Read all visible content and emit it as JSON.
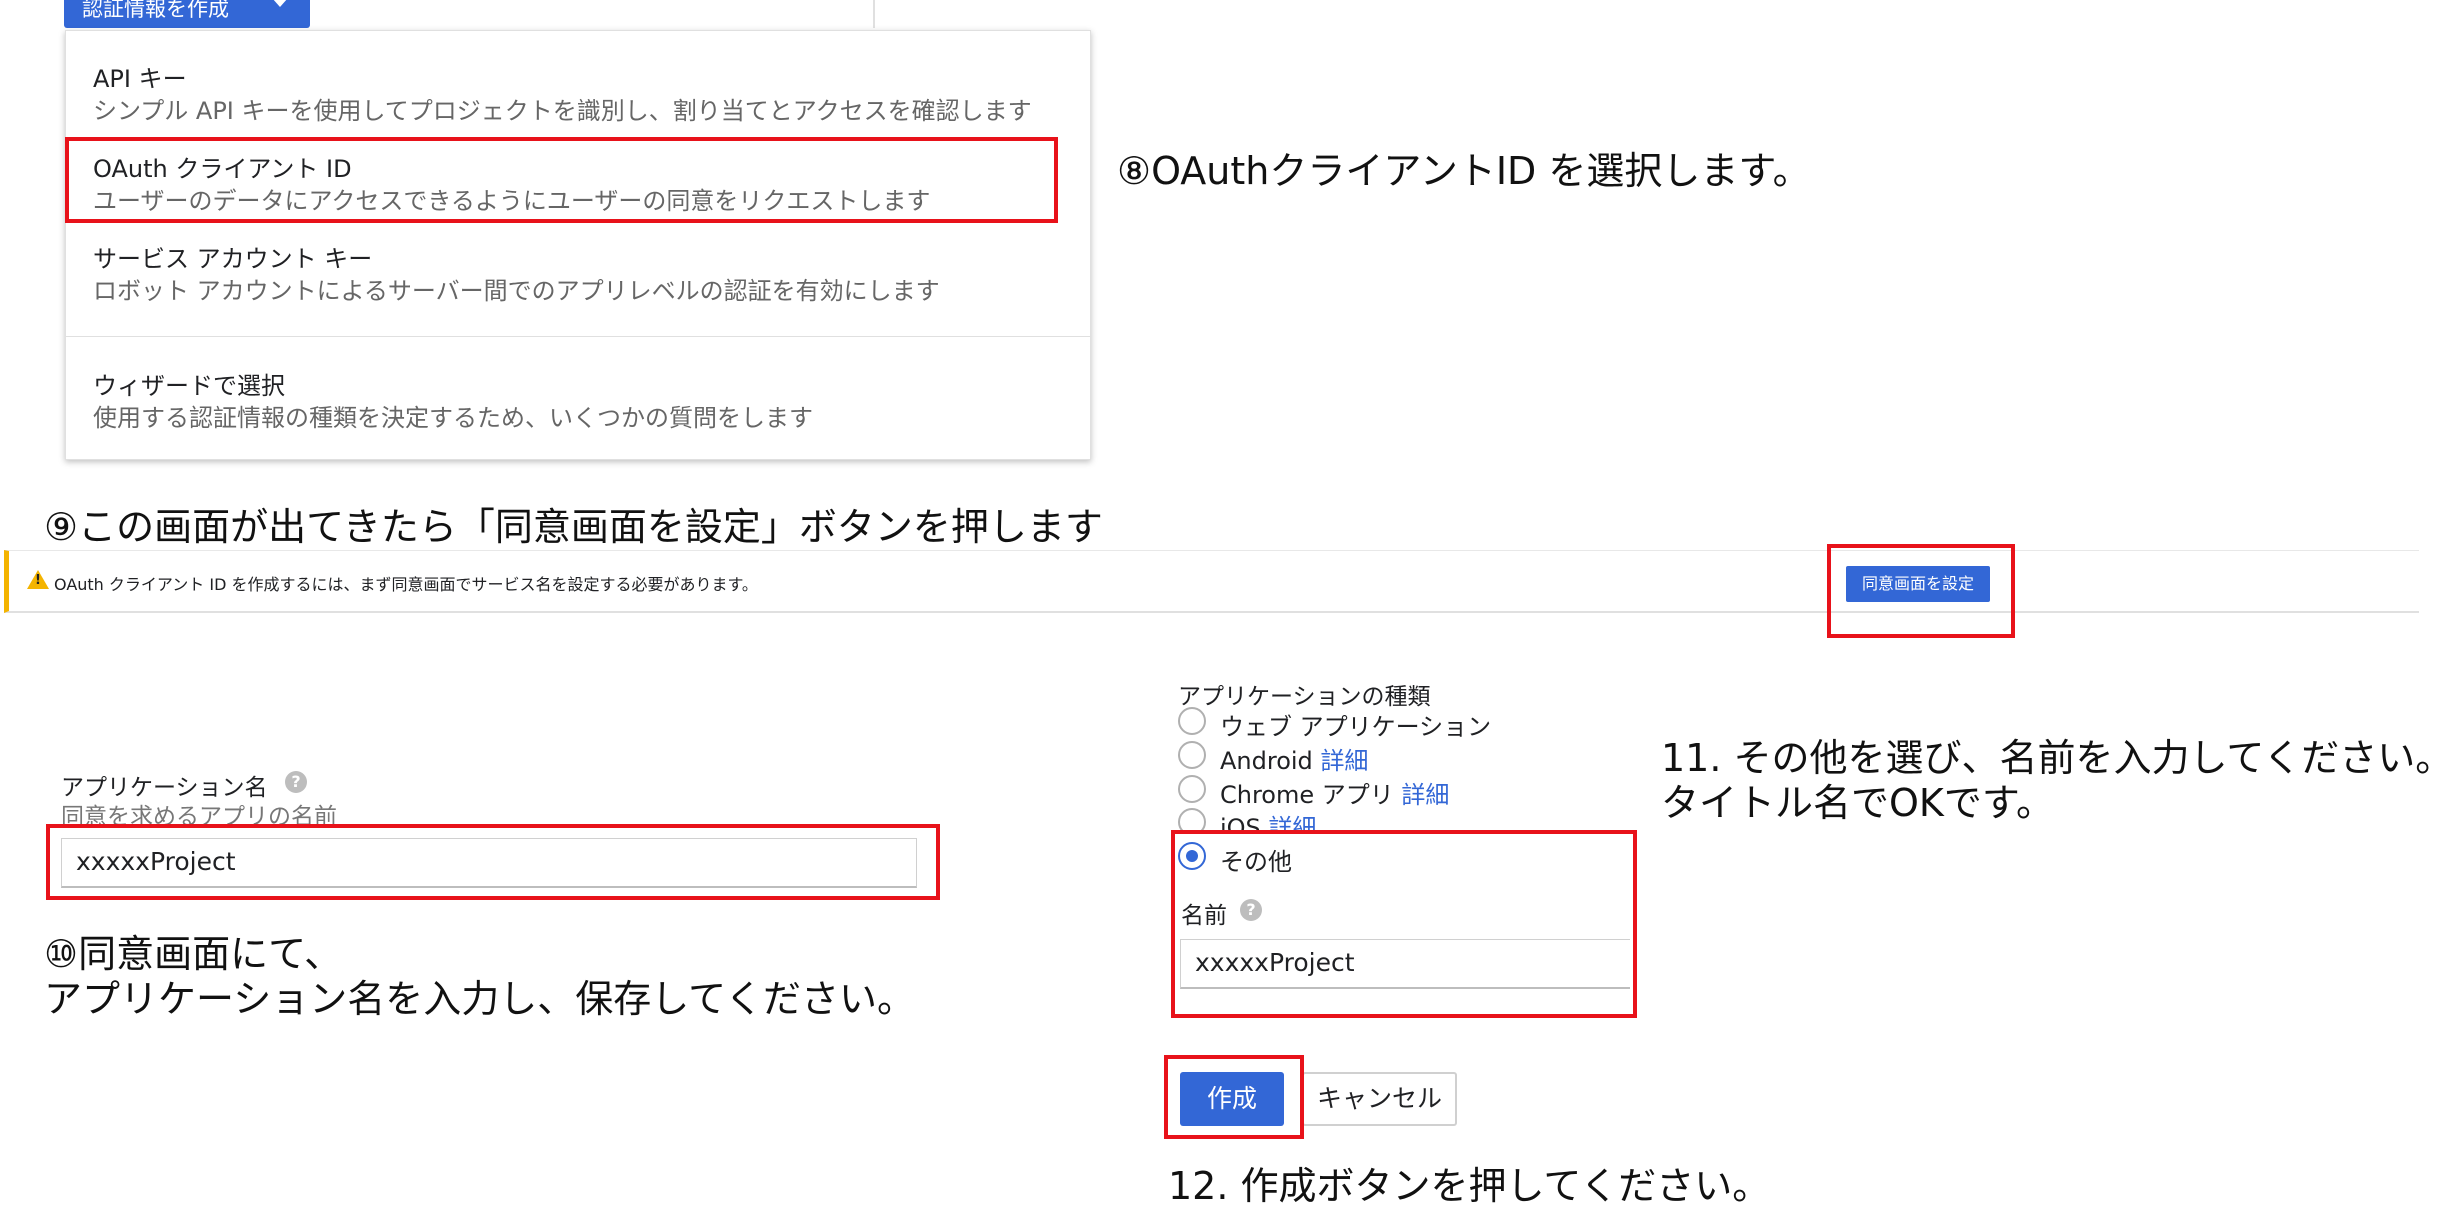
{
  "create_button": {
    "label": "認証情報を作成"
  },
  "menu": {
    "items": [
      {
        "title": "API キー",
        "desc": "シンプル API キーを使用してプロジェクトを識別し、割り当てとアクセスを確認します"
      },
      {
        "title": "OAuth クライアント ID",
        "desc": "ユーザーのデータにアクセスできるようにユーザーの同意をリクエストします"
      },
      {
        "title": "サービス アカウント キー",
        "desc": "ロボット アカウントによるサーバー間でのアプリレベルの認証を有効にします"
      },
      {
        "title": "ウィザードで選択",
        "desc": "使用する認証情報の種類を決定するため、いくつかの質問をします"
      }
    ]
  },
  "annotations": {
    "step8": "⑧OAuthクライアントID を選択します。",
    "step9": "⑨この画面が出てきたら「同意画面を設定」ボタンを押します",
    "step10_line1": "⑩同意画面にて、",
    "step10_line2": "アプリケーション名を入力し、保存してください。",
    "step11_line1": "11. その他を選び、名前を入力してください。",
    "step11_line2": "タイトル名でOKです。",
    "step12": "12. 作成ボタンを押してください。"
  },
  "banner": {
    "message": "OAuth クライアント ID を作成するには、まず同意画面でサービス名を設定する必要があります。",
    "button_label": "同意画面を設定"
  },
  "consent_form": {
    "app_name_label": "アプリケーション名",
    "app_name_hint": "同意を求めるアプリの名前",
    "app_name_value": "xxxxxProject"
  },
  "client_form": {
    "type_label": "アプリケーションの種類",
    "options": [
      {
        "label": "ウェブ アプリケーション",
        "link": ""
      },
      {
        "label": "Android",
        "link": "詳細"
      },
      {
        "label": "Chrome アプリ",
        "link": "詳細"
      },
      {
        "label": "iOS",
        "link": "詳細"
      },
      {
        "label": "その他",
        "link": ""
      }
    ],
    "selected": "その他",
    "name_label": "名前",
    "name_value": "xxxxxProject",
    "create_label": "作成",
    "cancel_label": "キャンセル"
  },
  "colors": {
    "accent": "#3367d6",
    "highlight": "#e8121a",
    "warning": "#f4b400"
  }
}
